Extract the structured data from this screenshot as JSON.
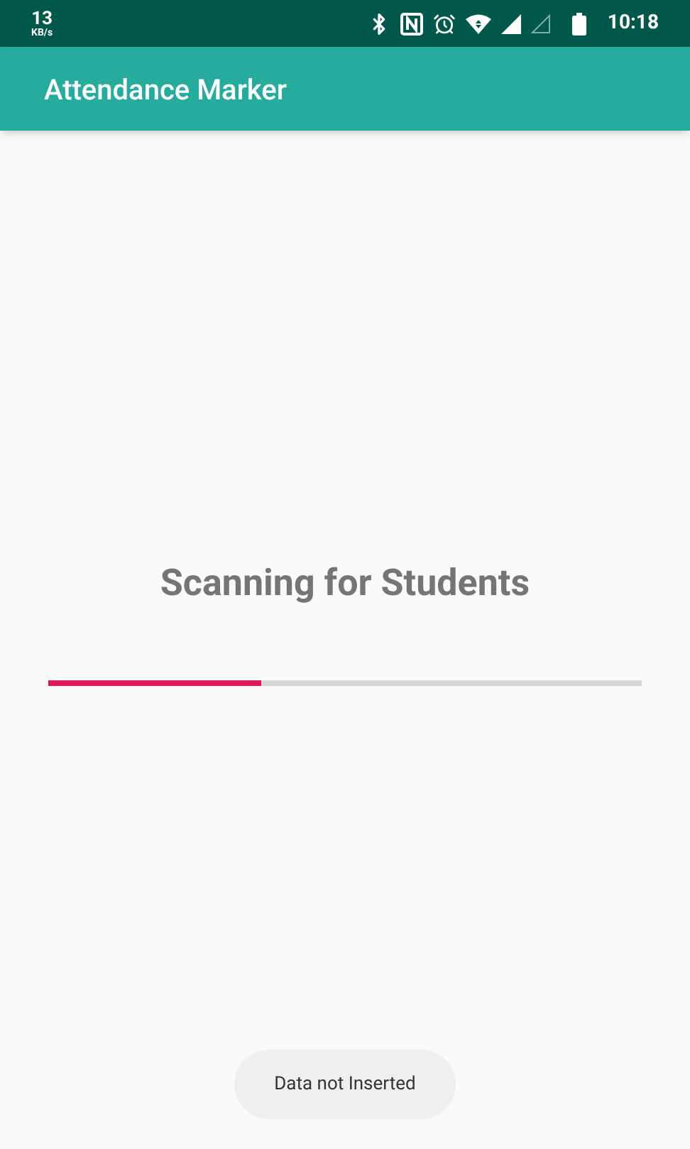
{
  "status_bar": {
    "speed_value": "13",
    "speed_unit": "KB/s",
    "time": "10:18"
  },
  "app_bar": {
    "title": "Attendance Marker"
  },
  "scan": {
    "title": "Scanning for Students",
    "progress": {
      "level": 0.36
    }
  },
  "toast": {
    "text": "Data not Inserted"
  }
}
